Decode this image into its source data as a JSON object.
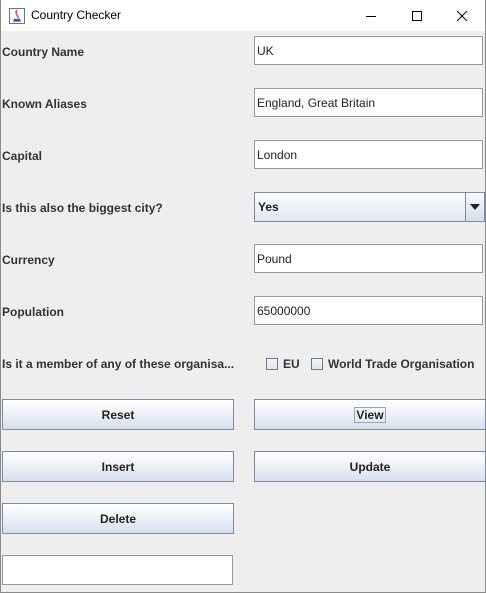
{
  "window": {
    "title": "Country Checker"
  },
  "form": {
    "country_name": {
      "label": "Country Name",
      "value": "UK"
    },
    "known_aliases": {
      "label": "Known Aliases",
      "value": "England, Great Britain"
    },
    "capital": {
      "label": "Capital",
      "value": "London"
    },
    "biggest_city": {
      "label": "Is this also the biggest city?",
      "value": "Yes"
    },
    "currency": {
      "label": "Currency",
      "value": "Pound"
    },
    "population": {
      "label": "Population",
      "value": "65000000"
    },
    "membership": {
      "label": "Is it a member of any of these organisa...",
      "options": [
        {
          "label": "EU",
          "checked": false
        },
        {
          "label": "World Trade Organisation",
          "checked": false
        }
      ]
    }
  },
  "buttons": {
    "reset": "Reset",
    "view": "View",
    "insert": "Insert",
    "update": "Update",
    "delete": "Delete"
  },
  "status_field": {
    "value": ""
  }
}
